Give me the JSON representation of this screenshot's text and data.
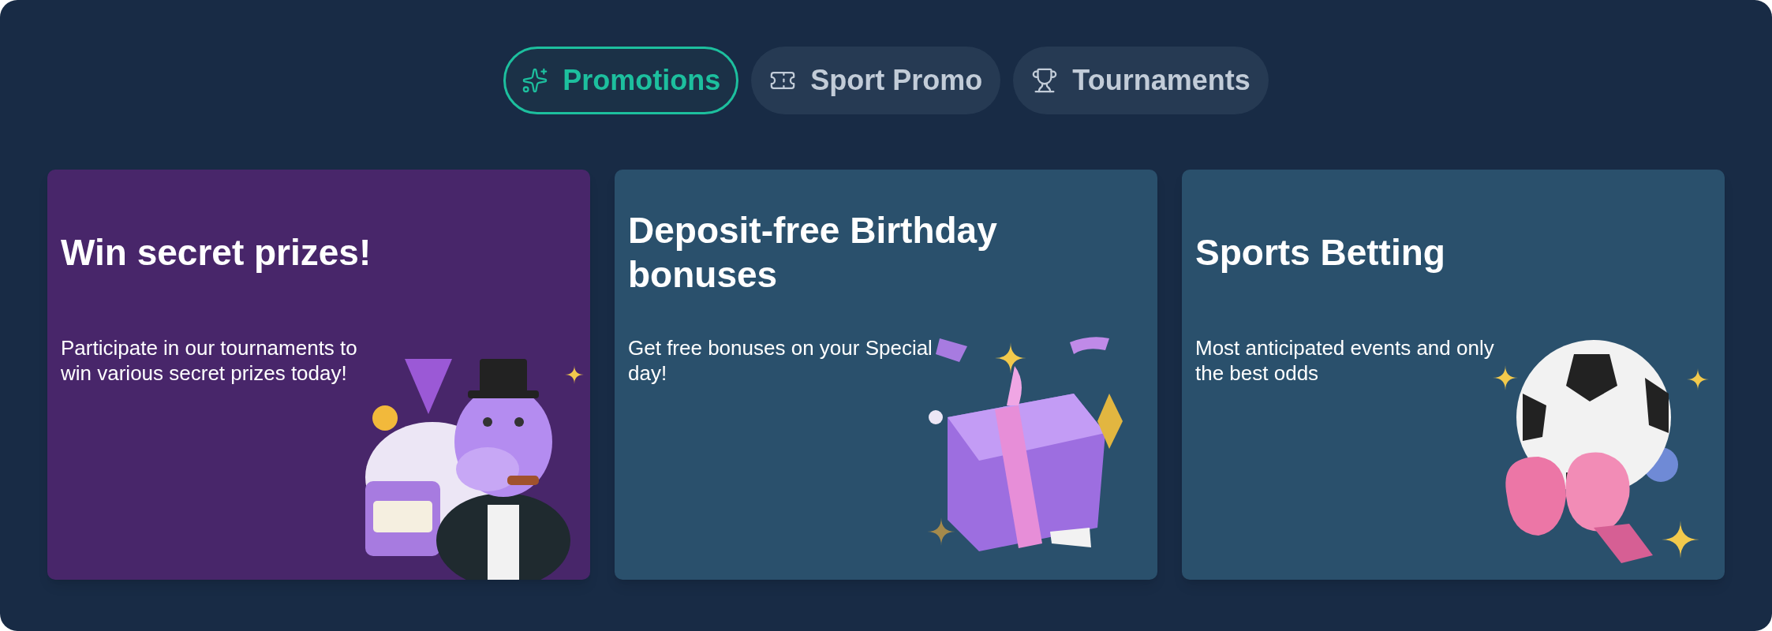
{
  "tabs": [
    {
      "label": "Promotions",
      "selected": true
    },
    {
      "label": "Sport Promo",
      "selected": false
    },
    {
      "label": "Tournaments",
      "selected": false
    }
  ],
  "cards": [
    {
      "kind": "hippo",
      "color": "#48266a",
      "title": "Win secret prizes!",
      "text": "Participate in our tournaments to win various secret prizes today!"
    },
    {
      "kind": "gift",
      "color": "#2a506c",
      "title": "Deposit-free Birthday bonuses",
      "text": "Get free bonuses on your Special day!"
    },
    {
      "kind": "ball",
      "color": "#2a506c",
      "title": "Sports Betting",
      "text": "Most anticipated events and only the best odds"
    }
  ]
}
